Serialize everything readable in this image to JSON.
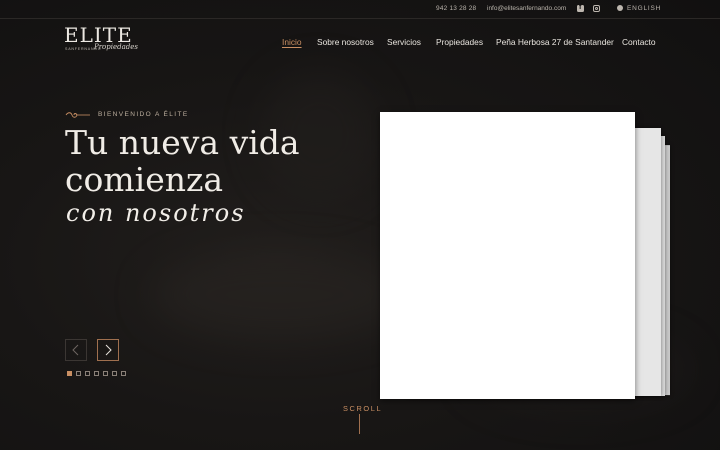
{
  "topbar": {
    "phone": "942 13 28 28",
    "email": "info@elitesanfernando.com",
    "language": "ENGLISH",
    "icons": [
      "facebook-icon",
      "instagram-icon",
      "globe-icon"
    ]
  },
  "logo": {
    "wordmark": "ELITE",
    "subtitle": "SANFERNANDO",
    "script": "Propiedades"
  },
  "nav": {
    "items": [
      {
        "label": "Inicio",
        "active": true
      },
      {
        "label": "Sobre nosotros",
        "active": false
      },
      {
        "label": "Servicios",
        "active": false
      },
      {
        "label": "Propiedades",
        "active": false
      },
      {
        "label": "Peña Herbosa 27 de Santander",
        "active": false
      },
      {
        "label": "Contacto",
        "active": false
      }
    ]
  },
  "hero": {
    "eyebrow": "BIENVENIDO A ÉLITE",
    "headline_line1": "Tu nueva vida",
    "headline_line2": "comienza",
    "script": "con nosotros"
  },
  "slider": {
    "slide_count": 7,
    "active_index": 0
  },
  "scroll": {
    "label": "SCROLL"
  },
  "colors": {
    "accent": "#c98f63",
    "background": "#121111",
    "text": "#f0ece6"
  }
}
